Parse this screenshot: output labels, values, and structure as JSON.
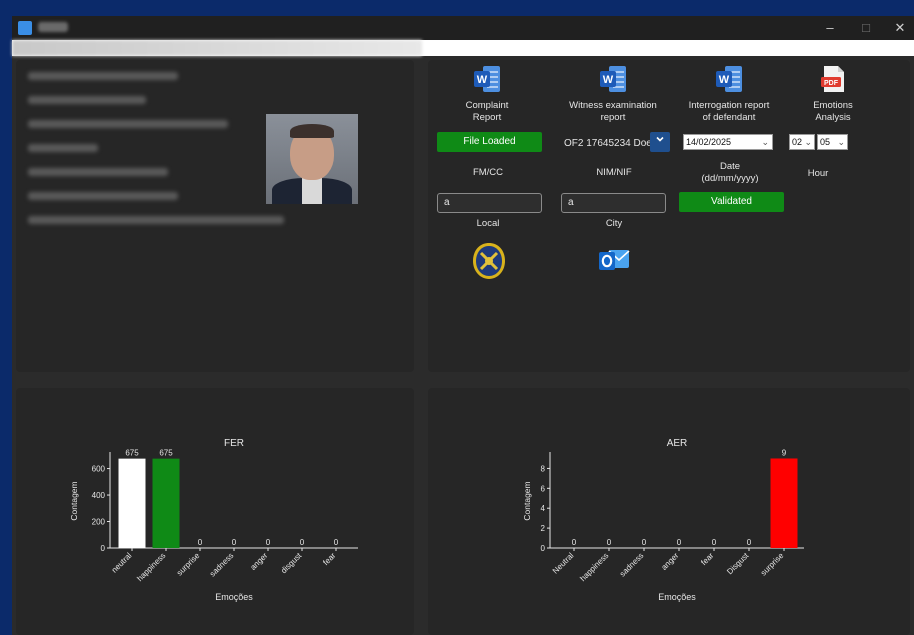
{
  "window": {
    "controls": {
      "minimize": "‒",
      "maximize": "□",
      "close": "✕"
    }
  },
  "reports": [
    {
      "label": "Complaint\nReport",
      "icon": "word-icon"
    },
    {
      "label": "Witness examination\nreport",
      "icon": "word-icon"
    },
    {
      "label": "Interrogation report\nof defendant",
      "icon": "word-icon"
    },
    {
      "label": "Emotions\nAnalysis",
      "icon": "pdf-icon"
    }
  ],
  "form": {
    "file_status": "File Loaded",
    "officer_select": "OF2 17645234 Doe",
    "date_value": "14/02/2025",
    "hour_value": "02",
    "minute_value": "05",
    "fmcc_label": "FM/CC",
    "nimnif_label": "NIM/NIF",
    "date_label": "Date\n(dd/mm/yyyy)",
    "hour_label": "Hour",
    "fmcc_value": "a",
    "nimnif_value": "a",
    "validated_label": "Validated",
    "local_label": "Local",
    "city_label": "City"
  },
  "colors": {
    "accent_green": "#0f8a16",
    "word_blue": "#2b6fd0",
    "pdf_red": "#e03b2f"
  },
  "chart_data": [
    {
      "type": "bar",
      "title": "FER",
      "xlabel": "Emoções",
      "ylabel": "Contagem",
      "categories": [
        "neutral",
        "happiness",
        "surprise",
        "sadness",
        "anger",
        "disgust",
        "fear"
      ],
      "values": [
        675,
        675,
        0,
        0,
        0,
        0,
        0
      ],
      "colors": [
        "#ffffff",
        "#0f8a16",
        "#ffffff",
        "#ffffff",
        "#ffffff",
        "#ffffff",
        "#ffffff"
      ],
      "yticks": [
        0,
        200,
        400,
        600
      ],
      "ylim": [
        0,
        710
      ]
    },
    {
      "type": "bar",
      "title": "AER",
      "xlabel": "Emoções",
      "ylabel": "Contagem",
      "categories": [
        "Neutral",
        "happiness",
        "sadness",
        "anger",
        "fear",
        "Disgust",
        "surprise"
      ],
      "values": [
        0,
        0,
        0,
        0,
        0,
        0,
        9
      ],
      "colors": [
        "#ffffff",
        "#ffffff",
        "#ffffff",
        "#ffffff",
        "#ffffff",
        "#ffffff",
        "#ff0000"
      ],
      "yticks": [
        0,
        2,
        4,
        6,
        8
      ],
      "ylim": [
        0,
        9.45
      ]
    }
  ]
}
